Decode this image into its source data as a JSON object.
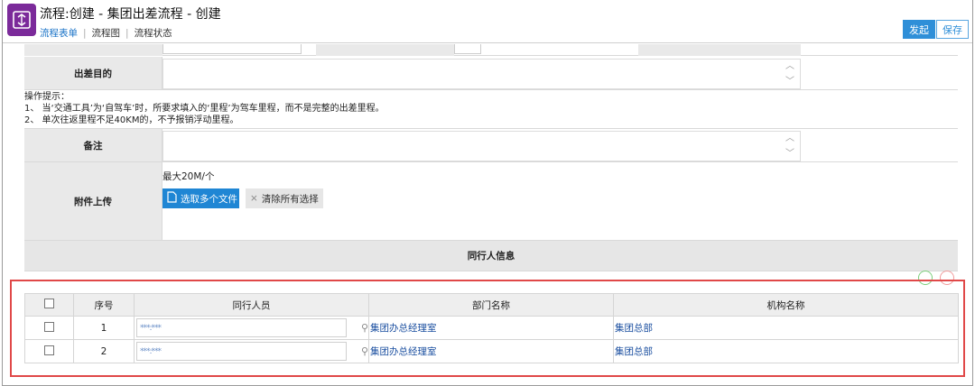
{
  "header": {
    "title": "流程:创建 - 集团出差流程 - 创建",
    "tabs": [
      {
        "label": "流程表单",
        "active": true
      },
      {
        "label": "流程图",
        "active": false
      },
      {
        "label": "流程状态",
        "active": false
      }
    ],
    "submit_label": "发起",
    "save_label": "保存"
  },
  "form": {
    "purpose_label": "出差目的",
    "hint_lines": [
      "操作提示：",
      "1、 当‘交通工具’为‘自驾车’时，所要求填入的‘里程’为驾车里程，而不是完整的出差里程。",
      "2、 单次往返里程不足40KM的，不予报销浮动里程。"
    ],
    "remark_label": "备注",
    "attachment_label": "附件上传",
    "attachment_max": "最大20M/个",
    "select_files_label": "选取多个文件",
    "clear_all_label": "清除所有选择",
    "companion_section_title": "同行人信息"
  },
  "companions": {
    "columns": [
      "",
      "序号",
      "同行人员",
      "部门名称",
      "机构名称"
    ],
    "rows": [
      {
        "no": "1",
        "person": "***:***",
        "department": "集团办总经理室",
        "org": "集团总部"
      },
      {
        "no": "2",
        "person": "***:***",
        "department": "集团办总经理室",
        "org": "集团总部"
      }
    ]
  },
  "colors": {
    "accent": "#2f8fd8",
    "logo": "#7b2a9a",
    "highlight_box": "#e04848"
  }
}
